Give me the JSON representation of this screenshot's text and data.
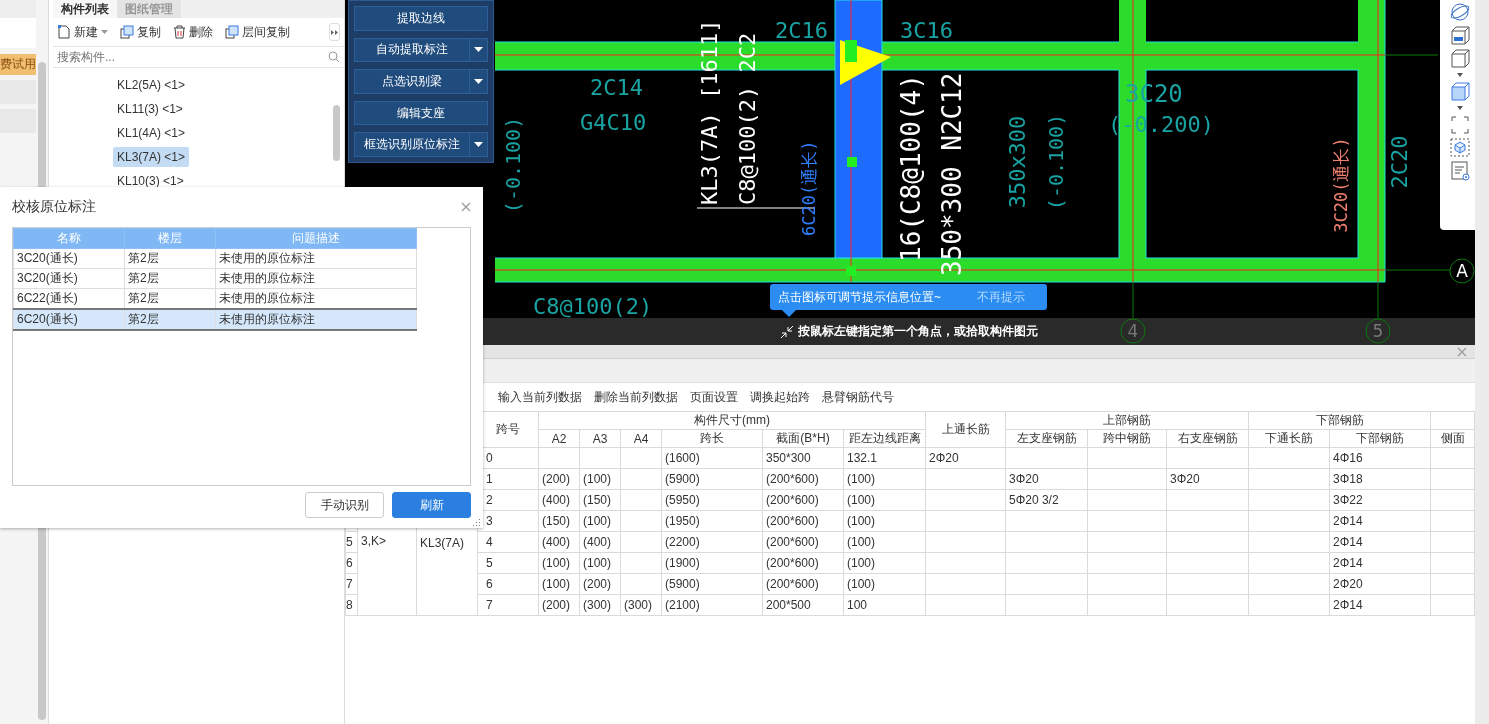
{
  "left_strip": {
    "badge": "费试用"
  },
  "component_panel": {
    "tabs": [
      {
        "label": "构件列表",
        "selected": true
      },
      {
        "label": "图纸管理",
        "selected": false
      }
    ],
    "toolbar": [
      {
        "label": "新建",
        "kind": "new",
        "has_dropdown": true
      },
      {
        "label": "复制",
        "kind": "copy",
        "has_dropdown": false
      },
      {
        "label": "删除",
        "kind": "delete",
        "has_dropdown": false
      },
      {
        "label": "层间复制",
        "kind": "copy",
        "has_dropdown": false
      }
    ],
    "search": {
      "placeholder": "搜索构件..."
    },
    "items": [
      {
        "label": "KL2(5A) <1>",
        "selected": false
      },
      {
        "label": "KL11(3) <1>",
        "selected": false
      },
      {
        "label": "KL1(4A) <1>",
        "selected": false
      },
      {
        "label": "KL3(7A) <1>",
        "selected": true
      },
      {
        "label": "KL10(3) <1>",
        "selected": false
      }
    ]
  },
  "recognition_panel": {
    "buttons": [
      {
        "label": "提取边线",
        "has_dropdown": false
      },
      {
        "label": "自动提取标注",
        "has_dropdown": true
      },
      {
        "label": "点选识别梁",
        "has_dropdown": true
      },
      {
        "label": "编辑支座",
        "has_dropdown": false
      },
      {
        "label": "框选识别原位标注",
        "has_dropdown": true
      }
    ]
  },
  "cad_canvas": {
    "labels": [
      {
        "text": "2C14",
        "kind": "horizontal",
        "color": "#1aa3a3"
      },
      {
        "text": "G4C10",
        "kind": "horizontal",
        "color": "#1aa3a3"
      },
      {
        "text": "(-0.100)",
        "kind": "vertical",
        "color": "#1aa3a3"
      },
      {
        "text": "KL3(7A) [1611]",
        "kind": "vertical",
        "color": "#ffffff"
      },
      {
        "text": "C8@100(2) 2C2",
        "kind": "vertical",
        "color": "#ffffff"
      },
      {
        "text": "2C16",
        "kind": "horizontal",
        "color": "#1aa3a3"
      },
      {
        "text": "3C16",
        "kind": "horizontal",
        "color": "#1aa3a3"
      },
      {
        "text": "6C20(通长)",
        "kind": "vertical",
        "color": "#2f7fff"
      },
      {
        "text": "16(C8@100(4)",
        "kind": "vertical",
        "color": "#ffffff"
      },
      {
        "text": "350*300 N2C12",
        "kind": "vertical",
        "color": "#ffffff"
      },
      {
        "text": "350x300",
        "kind": "vertical",
        "color": "#1aa3a3"
      },
      {
        "text": "(-0.100)",
        "kind": "vertical",
        "color": "#1aa3a3"
      },
      {
        "text": "3C20",
        "kind": "horizontal",
        "color": "#1aa3a3"
      },
      {
        "text": "(-0.200)",
        "kind": "horizontal",
        "color": "#1aa3a3"
      },
      {
        "text": "3C20(通长)",
        "kind": "vertical",
        "color": "#f08070"
      },
      {
        "text": "2C20",
        "kind": "vertical",
        "color": "#1aa3a3"
      },
      {
        "text": "C8@100(2)",
        "kind": "horizontal",
        "color": "#1aa3a3"
      }
    ],
    "axis_markers": [
      "A",
      "4",
      "5"
    ]
  },
  "hint_tooltip": {
    "text": "点击图标可调节提示信息位置~",
    "dismiss": "不再提示"
  },
  "status_bar": {
    "text": "按鼠标左键指定第一个角点，或拾取构件图元"
  },
  "span_editor": {
    "toolbar": [
      "输入当前列数据",
      "删除当前列数据",
      "页面设置",
      "调换起始跨",
      "悬臂钢筋代号"
    ],
    "table": {
      "headers": [
        {
          "label": "跨号"
        },
        {
          "group": "构件尺寸(mm)",
          "columns": [
            "A2",
            "A3",
            "A4",
            "跨长",
            "截面(B*H)",
            "距左边线距离"
          ]
        },
        {
          "label": "上通长筋"
        },
        {
          "group": "上部钢筋",
          "columns": [
            "左支座钢筋",
            "跨中钢筋",
            "右支座钢筋"
          ]
        },
        {
          "group": "下部钢筋",
          "columns": [
            "下通长筋",
            "下部钢筋"
          ]
        },
        {
          "columns": [
            "侧面"
          ]
        }
      ],
      "merged_cells": {
        "column_2": "3,K>",
        "column_3": "KL3(7A)"
      },
      "rows": [
        {
          "cells": [
            "0",
            null,
            null,
            null,
            "(1600)",
            "350*300",
            "132.1",
            "2Φ20",
            null,
            null,
            null,
            null,
            "4Φ16",
            null
          ]
        },
        {
          "cells": [
            "1",
            "(200)",
            "(100)",
            null,
            "(5900)",
            "(200*600)",
            "(100)",
            null,
            "3Φ20",
            null,
            "3Φ20",
            null,
            "3Φ18",
            null
          ]
        },
        {
          "cells": [
            "2",
            "(400)",
            "(150)",
            null,
            "(5950)",
            "(200*600)",
            "(100)",
            null,
            "5Φ20 3/2",
            null,
            null,
            null,
            "3Φ22",
            null
          ]
        },
        {
          "cells": [
            "3",
            "(150)",
            "(100)",
            null,
            "(1950)",
            "(200*600)",
            "(100)",
            null,
            null,
            null,
            null,
            null,
            "2Φ14",
            null
          ]
        },
        {
          "row_number": "5",
          "cells": [
            "4",
            "(400)",
            "(400)",
            null,
            "(2200)",
            "(200*600)",
            "(100)",
            null,
            null,
            null,
            null,
            null,
            "2Φ14",
            null
          ]
        },
        {
          "row_number": "6",
          "cells": [
            "5",
            "(100)",
            "(100)",
            null,
            "(1900)",
            "(200*600)",
            "(100)",
            null,
            null,
            null,
            null,
            null,
            "2Φ14",
            null
          ]
        },
        {
          "row_number": "7",
          "cells": [
            "6",
            "(100)",
            "(200)",
            null,
            "(5900)",
            "(200*600)",
            "(100)",
            null,
            null,
            null,
            null,
            null,
            "2Φ20",
            null
          ]
        },
        {
          "row_number": "8",
          "cells": [
            "7",
            "(200)",
            "(300)",
            "(300)",
            "(2100)",
            "200*500",
            "100",
            null,
            null,
            null,
            null,
            null,
            "2Φ14",
            null
          ]
        }
      ]
    }
  },
  "check_dialog": {
    "title": "校核原位标注",
    "columns": [
      "名称",
      "楼层",
      "问题描述"
    ],
    "rows": [
      {
        "cells": [
          "3C20(通长)",
          "第2层",
          "未使用的原位标注"
        ],
        "selected": false
      },
      {
        "cells": [
          "3C20(通长)",
          "第2层",
          "未使用的原位标注"
        ],
        "selected": false
      },
      {
        "cells": [
          "6C22(通长)",
          "第2层",
          "未使用的原位标注"
        ],
        "selected": false
      },
      {
        "cells": [
          "6C20(通长)",
          "第2层",
          "未使用的原位标注"
        ],
        "selected": true
      }
    ],
    "buttons": [
      {
        "label": "手动识别",
        "kind": "secondary"
      },
      {
        "label": "刷新",
        "kind": "primary"
      }
    ]
  }
}
